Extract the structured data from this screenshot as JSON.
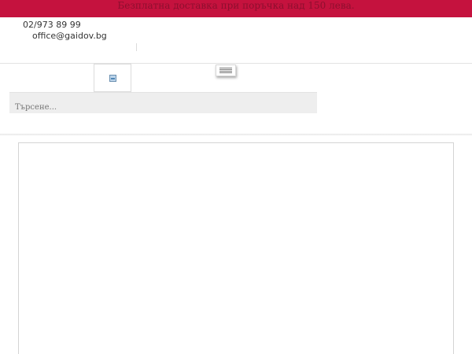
{
  "promo": {
    "text": "Безплатна доставка при поръчка над 150 лева."
  },
  "contact": {
    "phone": "02/973 89 99",
    "email": "office@gaidov.bg"
  },
  "logo": {
    "icon": "broken-image-icon"
  },
  "menu": {
    "icon": "hamburger-menu-icon"
  },
  "search": {
    "placeholder": "Търсене..."
  },
  "colors": {
    "accent": "#c5123e",
    "search_bg": "#eeeeee",
    "border": "#d4d4d4"
  }
}
